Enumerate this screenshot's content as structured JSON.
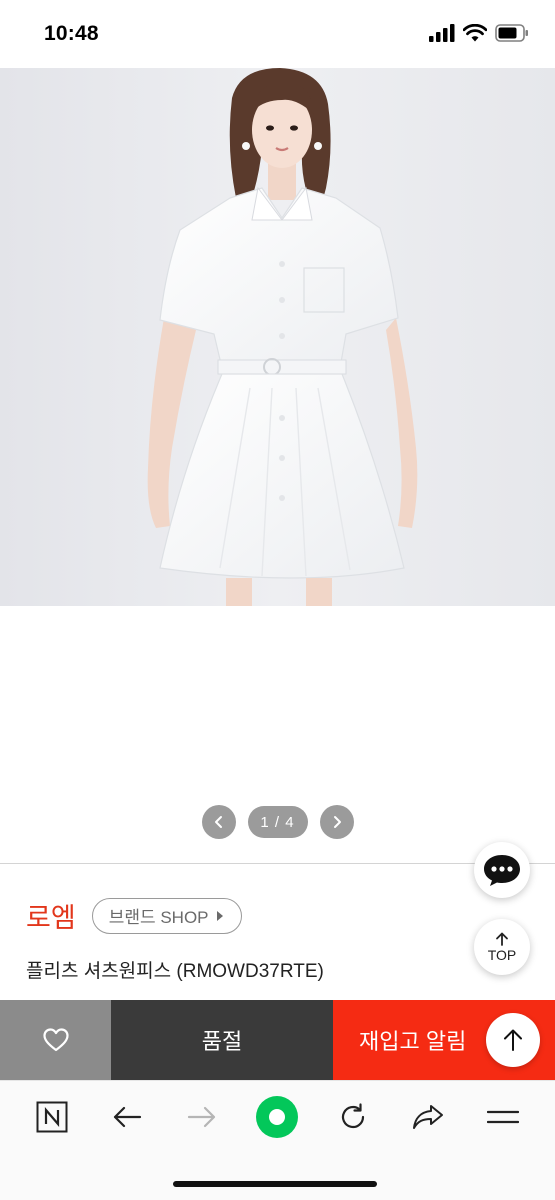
{
  "status_bar": {
    "time": "10:48"
  },
  "gallery": {
    "counter": "1 / 4"
  },
  "brand": {
    "name": "로엠",
    "shop_label": "브랜드 SHOP"
  },
  "product": {
    "title": "플리츠 셔츠원피스 (RMOWD37RTE)"
  },
  "floating": {
    "top_label": "TOP"
  },
  "actions": {
    "soldout_label": "품절",
    "restock_label": "재입고 알림"
  },
  "colors": {
    "brand_red": "#e2361b",
    "restock_red": "#f52b13",
    "soldout_dark": "#3a3a3a",
    "wish_gray": "#8b8b8b",
    "naver_green": "#03c75a"
  },
  "icons": {
    "status": [
      "signal-icon",
      "wifi-icon",
      "battery-icon"
    ],
    "gallery": [
      "chevron-left-icon",
      "chevron-right-icon"
    ],
    "floating": [
      "chat-icon",
      "arrow-up-icon"
    ],
    "action_bar": [
      "heart-icon",
      "arrow-up-icon"
    ],
    "browser": [
      "naver-n-icon",
      "back-arrow-icon",
      "forward-arrow-icon",
      "green-dot-icon",
      "reload-icon",
      "share-icon",
      "menu-icon"
    ]
  }
}
